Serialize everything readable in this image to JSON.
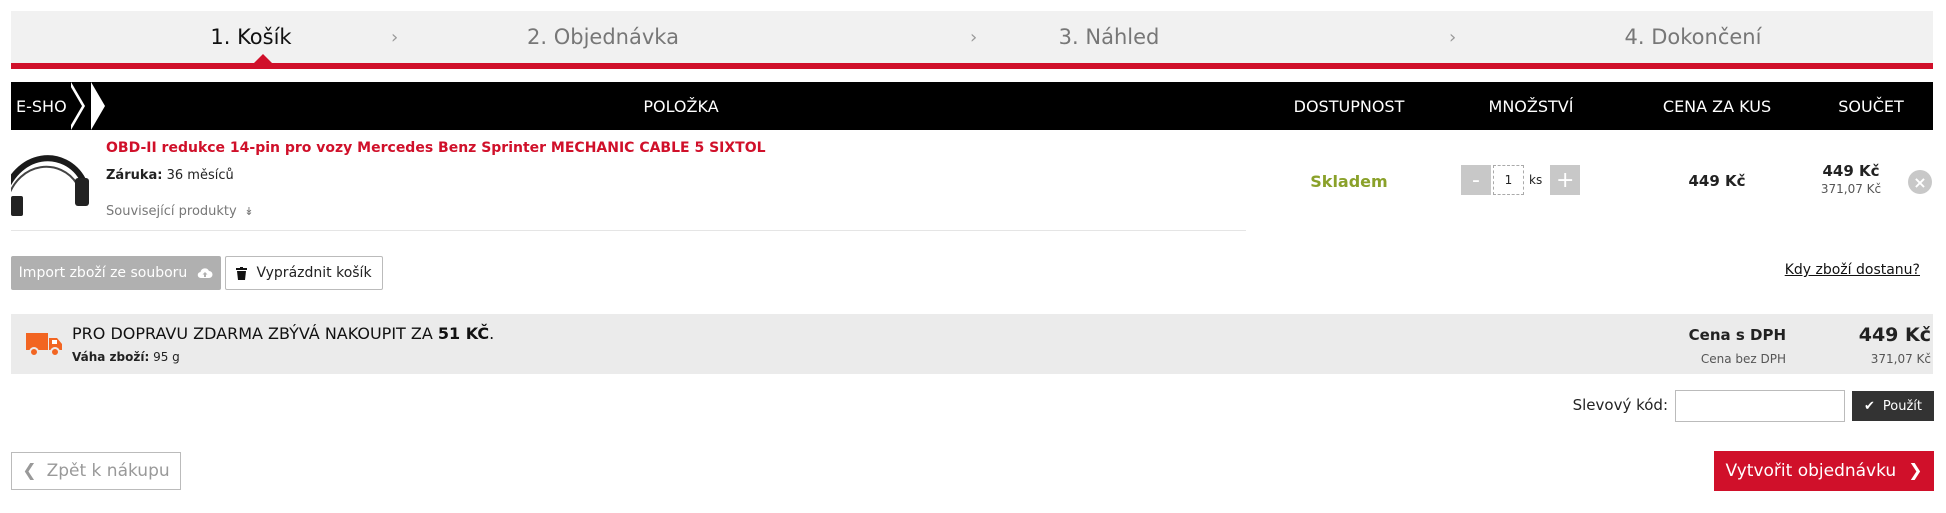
{
  "steps": [
    {
      "label": "1. Košík",
      "active": true
    },
    {
      "label": "2. Objednávka",
      "active": false
    },
    {
      "label": "3. Náhled",
      "active": false
    },
    {
      "label": "4. Dokončení",
      "active": false
    }
  ],
  "table_header": {
    "eshop": "E-SHOP",
    "item": "POLOŽKA",
    "availability": "DOSTUPNOST",
    "quantity": "MNOŽSTVÍ",
    "unit_price": "CENA ZA KUS",
    "total": "SOUČET"
  },
  "cart_item": {
    "name": "OBD-II redukce 14-pin pro vozy Mercedes Benz Sprinter MECHANIC CABLE 5 SIXTOL",
    "warranty_label": "Záruka:",
    "warranty_value": "36 měsíců",
    "related_label": "Související produkty",
    "availability": "Skladem",
    "quantity": "1",
    "quantity_unit": "ks",
    "decrement": "-",
    "increment": "+",
    "unit_price": "449 Kč",
    "total_vat": "449 Kč",
    "total_novat": "371,07 Kč"
  },
  "actions": {
    "import_label": "Import zboží ze souboru",
    "empty_label": "Vyprázdnit košík",
    "when_link": "Kdy zboží dostanu?"
  },
  "shipping": {
    "text_before": "PRO DOPRAVU ZDARMA ZBÝVÁ NAKOUPIT ZA ",
    "amount": "51 KČ",
    "text_after": ".",
    "weight_label": "Váha zboží:",
    "weight_value": "95 g"
  },
  "summary": {
    "vat_label": "Cena s DPH",
    "vat_value": "449 Kč",
    "novat_label": "Cena bez DPH",
    "novat_value": "371,07 Kč"
  },
  "discount": {
    "label": "Slevový kód:",
    "value": "",
    "apply_label": "Použít"
  },
  "nav": {
    "back_label": "Zpět k nákupu",
    "order_label": "Vytvořit objednávku"
  },
  "colors": {
    "accent": "#d0102a",
    "in_stock": "#8aa12a",
    "truck": "#f26522"
  },
  "icons": {
    "upload": "cloud-upload-icon",
    "trash": "trash-icon",
    "check": "check-icon",
    "truck": "truck-icon",
    "remove": "close-icon"
  }
}
